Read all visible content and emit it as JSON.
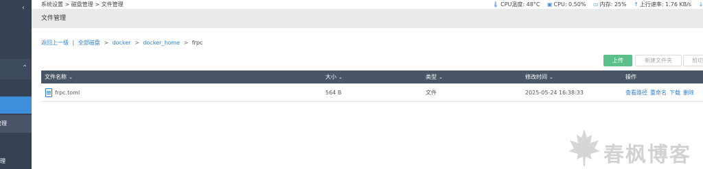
{
  "sidebar": {
    "collapse_chevron": "‹",
    "group_chevron": "⌃",
    "highlighted_item_label": "管理",
    "bottom_label": "理"
  },
  "topbar": {
    "breadcrumb": "系统设置 > 磁盘管理 > 文件管理",
    "stats": {
      "cpu_temp": "CPU温度: 48°C",
      "cpu_usage": "CPU: 0.50%",
      "memory": "内存: 25%",
      "upload_speed": "上行速率: 1.76 KB/s",
      "download_speed_partial": "下"
    }
  },
  "page": {
    "title": "文件管理"
  },
  "path_nav": {
    "back_label": "返回上一级",
    "separator": "|",
    "crumbs": [
      "全部磁盘",
      "docker",
      "docker_home"
    ],
    "current": "frpc"
  },
  "toolbar": {
    "upload_label": "上传",
    "new_folder_label": "新建文件夹",
    "cut_label": "剪切"
  },
  "table": {
    "columns": [
      "文件名称",
      "大小",
      "类型",
      "修改时间",
      "操作"
    ],
    "rows": [
      {
        "name": "frpc.toml",
        "size": "564 B",
        "type": "文件",
        "modified": "2025-05-24 16:38:33",
        "actions": [
          "查看路径",
          "重命名",
          "下载",
          "删除"
        ]
      }
    ]
  },
  "watermark": {
    "text": "春枫博客",
    "icon": "maple-leaf-icon"
  },
  "colors": {
    "sidebar_bg": "#364154",
    "sidebar_active": "#3d8fdc",
    "table_header_bg": "#4a5568",
    "upload_button": "#5cc08d",
    "link": "#2b7fd4"
  }
}
